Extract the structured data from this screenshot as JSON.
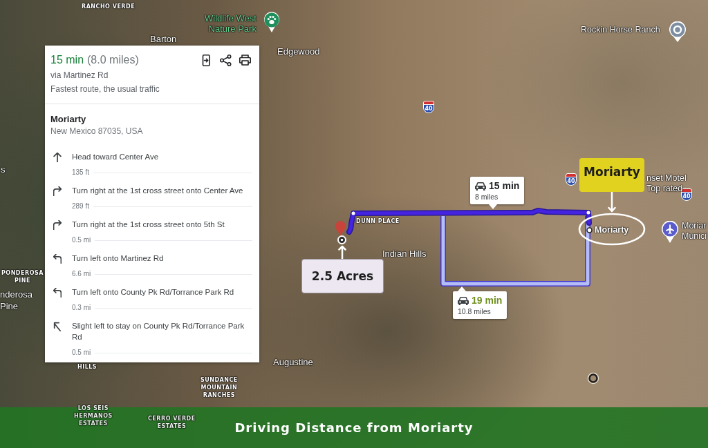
{
  "directions_panel": {
    "duration": "15 min",
    "distance": "(8.0 miles)",
    "via": "via Martinez Rd",
    "traffic_note": "Fastest route, the usual traffic",
    "destination": {
      "name": "Moriarty",
      "address": "New Mexico 87035, USA"
    },
    "steps": [
      {
        "kind": "straight",
        "instruction": "Head toward Center Ave",
        "distance": "135 ft"
      },
      {
        "kind": "turn-right",
        "instruction": "Turn right at the 1st cross street onto Center Ave",
        "distance": "289 ft"
      },
      {
        "kind": "turn-right",
        "instruction": "Turn right at the 1st cross street onto 5th St",
        "distance": "0.5 mi"
      },
      {
        "kind": "turn-left",
        "instruction": "Turn left onto Martinez Rd",
        "distance": "6.6 mi"
      },
      {
        "kind": "turn-left",
        "instruction": "Turn left onto County Pk Rd/Torrance Park Rd",
        "distance": "0.3 mi"
      },
      {
        "kind": "slight-left",
        "instruction": "Slight left to stay on County Pk Rd/Torrance Park Rd",
        "distance": "0.5 mi"
      }
    ]
  },
  "map": {
    "labels": [
      {
        "kind": "area",
        "lines": [
          "RANCHO VERDE"
        ]
      },
      {
        "kind": "park",
        "lines": [
          "Wildlife West",
          "Nature Park"
        ]
      },
      {
        "kind": "town",
        "lines": [
          "Barton"
        ]
      },
      {
        "kind": "town",
        "lines": [
          "Edgewood"
        ]
      },
      {
        "kind": "poi",
        "lines": [
          "Rockin Horse Ranch"
        ]
      },
      {
        "kind": "poi",
        "lines": [
          "nset Motel"
        ]
      },
      {
        "kind": "poi",
        "lines": [
          "Top rated"
        ]
      },
      {
        "kind": "town",
        "lines": [
          "s"
        ]
      },
      {
        "kind": "road",
        "lines": [
          "DUNN PLACE"
        ]
      },
      {
        "kind": "town",
        "lines": [
          "Indian Hills"
        ]
      },
      {
        "kind": "poi",
        "lines": [
          "Moriar",
          "Munici"
        ]
      },
      {
        "kind": "area",
        "lines": [
          "PONDEROSA",
          "PINE"
        ]
      },
      {
        "kind": "town",
        "lines": [
          "nderosa",
          "Pine"
        ]
      },
      {
        "kind": "town",
        "lines": [
          "Augustine"
        ]
      },
      {
        "kind": "area",
        "lines": [
          "HILLS"
        ]
      },
      {
        "kind": "area",
        "lines": [
          "SUNDANCE",
          "MOUNTAIN",
          "RANCHES"
        ]
      },
      {
        "kind": "area",
        "lines": [
          "LOS SEIS",
          "HERMANOS",
          "ESTATES"
        ]
      },
      {
        "kind": "area",
        "lines": [
          "CERRO VERDE",
          "ESTATES"
        ]
      }
    ],
    "highway_shields": [
      {
        "text": "40"
      },
      {
        "text": "40"
      },
      {
        "text": "40"
      }
    ],
    "routes": [
      {
        "duration": "15 min",
        "distance": "8 miles",
        "selected": true
      },
      {
        "duration": "19 min",
        "distance": "10.8 miles",
        "selected": false
      }
    ],
    "callouts": [
      {
        "kind": "acreage",
        "text": "2.5 Acres"
      },
      {
        "kind": "town",
        "text": "Moriarty"
      }
    ],
    "circled_place": {
      "text": "Moriarty"
    }
  },
  "banner": {
    "title": "Driving Distance from Moriarty"
  }
}
